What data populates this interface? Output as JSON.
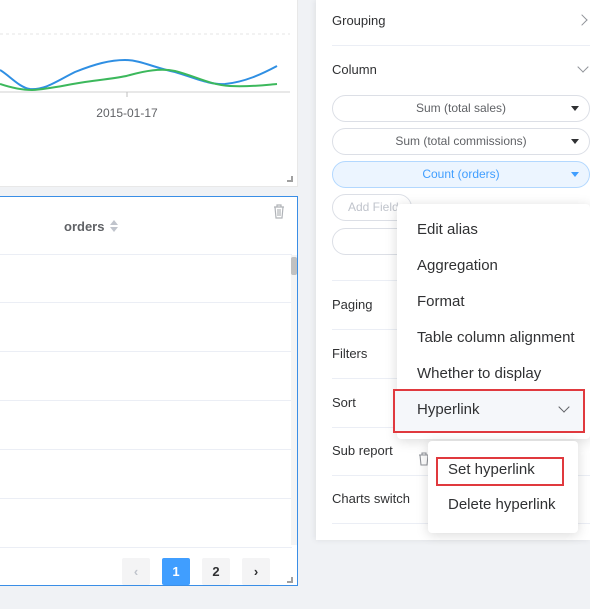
{
  "chart": {
    "x_tick": "2015-01-17"
  },
  "table": {
    "column_header": "orders",
    "pagination": {
      "prev": "‹",
      "pages": [
        "1",
        "2"
      ],
      "next": "›",
      "current_page": "1"
    }
  },
  "panel": {
    "grouping_label": "Grouping",
    "column_label": "Column",
    "fields": [
      {
        "label": "Sum (total sales)"
      },
      {
        "label": "Sum (total commissions)"
      },
      {
        "label": "Count (orders)"
      }
    ],
    "add_field_placeholder": "Add Field",
    "paging_label": "Paging",
    "filters_label": "Filters",
    "sort_label": "Sort",
    "sub_report_label": "Sub report",
    "charts_switch_label": "Charts switch"
  },
  "menu": {
    "items": [
      "Edit alias",
      "Aggregation",
      "Format",
      "Table column alignment",
      "Whether to display",
      "Hyperlink"
    ]
  },
  "submenu": {
    "items": [
      "Set hyperlink",
      "Delete hyperlink"
    ]
  },
  "colors": {
    "accent": "#409eff",
    "highlight_border": "#e0393e",
    "series_blue": "#2f8fe3",
    "series_green": "#3cb85c"
  }
}
